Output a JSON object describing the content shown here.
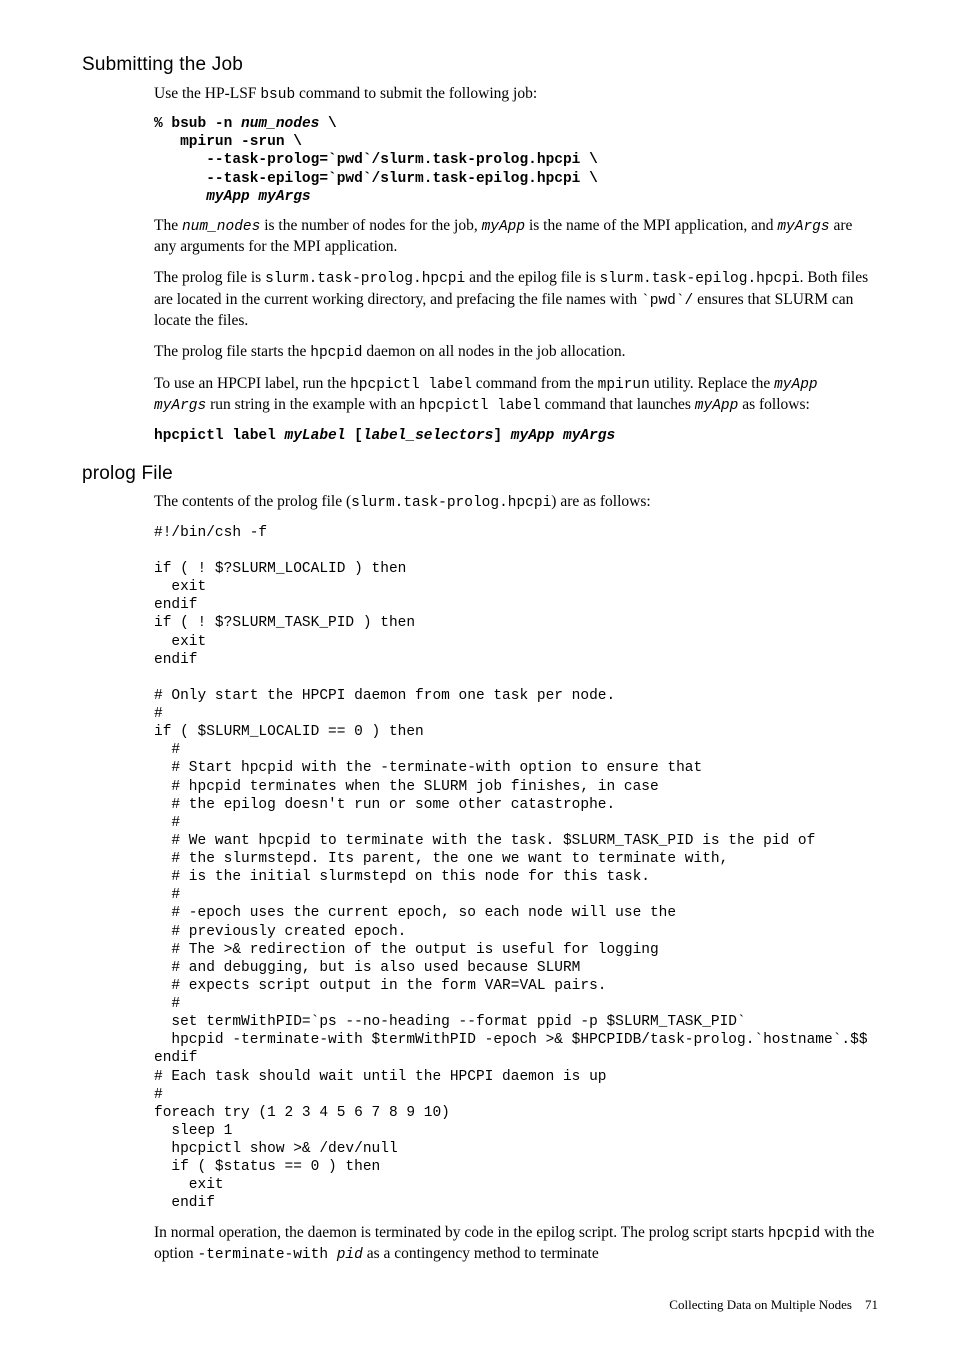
{
  "section1": {
    "title": "Submitting the Job",
    "p1_a": "Use the HP-LSF ",
    "p1_code": "bsub",
    "p1_b": " command to submit the following job:",
    "code1": "% bsub -n num_nodes \\\n   mpirun -srun \\\n      --task-prolog=`pwd`/slurm.task-prolog.hpcpi \\\n      --task-epilog=`pwd`/slurm.task-epilog.hpcpi \\\n      myApp myArgs",
    "p2_a": "The ",
    "p2_code1": "num_nodes",
    "p2_b": " is the number of nodes for the job, ",
    "p2_code2": "myApp",
    "p2_c": " is the name of the MPI application, and ",
    "p2_code3": "myArgs",
    "p2_d": " are any arguments for the MPI application.",
    "p3_a": "The prolog file is ",
    "p3_code1": "slurm.task-prolog.hpcpi",
    "p3_b": " and the epilog file is ",
    "p3_code2": "slurm.task-epilog.hpcpi",
    "p3_c": ". Both files are located in the current working directory, and prefacing the file names with ",
    "p3_code3": "`pwd`/",
    "p3_d": " ensures that SLURM can locate the files.",
    "p4_a": "The prolog file starts the ",
    "p4_code1": "hpcpid",
    "p4_b": " daemon on all nodes in the job allocation.",
    "p5_a": "To use an HPCPI label, run the ",
    "p5_code1": "hpcpictl label",
    "p5_b": " command from the ",
    "p5_code2": "mpirun",
    "p5_c": " utility. Replace the ",
    "p5_code3": "myApp myArgs",
    "p5_d": " run string in the example with an ",
    "p5_code4": "hpcpictl label",
    "p5_e": " command that launches ",
    "p5_code5": "myApp",
    "p5_f": " as follows:",
    "code2_a": "hpcpictl label ",
    "code2_b": "myLabel",
    "code2_c": " [",
    "code2_d": "label_selectors",
    "code2_e": "] ",
    "code2_f": "myApp myArgs"
  },
  "section2": {
    "title": "prolog File",
    "p1_a": "The contents of the prolog file (",
    "p1_code1": "slurm.task-prolog.hpcpi",
    "p1_b": ") are as follows:",
    "code": "#!/bin/csh -f\n\nif ( ! $?SLURM_LOCALID ) then\n  exit\nendif\nif ( ! $?SLURM_TASK_PID ) then\n  exit\nendif\n\n# Only start the HPCPI daemon from one task per node.\n#\nif ( $SLURM_LOCALID == 0 ) then\n  #\n  # Start hpcpid with the -terminate-with option to ensure that\n  # hpcpid terminates when the SLURM job finishes, in case\n  # the epilog doesn't run or some other catastrophe.\n  #\n  # We want hpcpid to terminate with the task. $SLURM_TASK_PID is the pid of\n  # the slurmstepd. Its parent, the one we want to terminate with,\n  # is the initial slurmstepd on this node for this task.\n  #\n  # -epoch uses the current epoch, so each node will use the\n  # previously created epoch.\n  # The >& redirection of the output is useful for logging\n  # and debugging, but is also used because SLURM\n  # expects script output in the form VAR=VAL pairs.\n  #\n  set termWithPID=`ps --no-heading --format ppid -p $SLURM_TASK_PID`\n  hpcpid -terminate-with $termWithPID -epoch >& $HPCPIDB/task-prolog.`hostname`.$$\nendif\n# Each task should wait until the HPCPI daemon is up\n#\nforeach try (1 2 3 4 5 6 7 8 9 10)\n  sleep 1\n  hpcpictl show >& /dev/null\n  if ( $status == 0 ) then\n    exit\n  endif",
    "p2_a": "In normal operation, the daemon is terminated by code in the epilog script. The prolog script starts ",
    "p2_code1": "hpcpid",
    "p2_b": " with the option ",
    "p2_code2": "-terminate-with ",
    "p2_code2i": "pid",
    "p2_c": " as a contingency method to terminate"
  },
  "footer": {
    "text": "Collecting Data on Multiple Nodes",
    "page": "71"
  }
}
